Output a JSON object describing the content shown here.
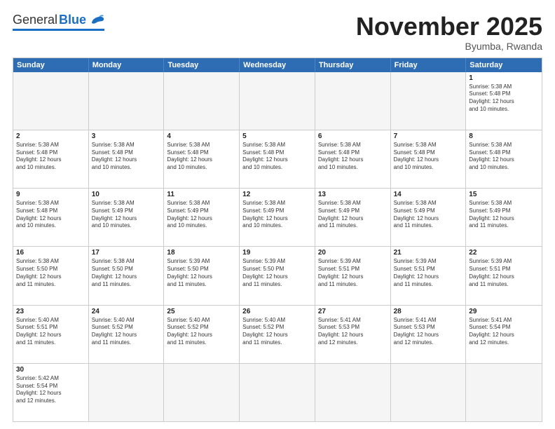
{
  "header": {
    "logo_general": "General",
    "logo_blue": "Blue",
    "month_title": "November 2025",
    "subtitle": "Byumba, Rwanda"
  },
  "weekdays": [
    "Sunday",
    "Monday",
    "Tuesday",
    "Wednesday",
    "Thursday",
    "Friday",
    "Saturday"
  ],
  "weeks": [
    [
      {
        "day": "",
        "empty": true
      },
      {
        "day": "",
        "empty": true
      },
      {
        "day": "",
        "empty": true
      },
      {
        "day": "",
        "empty": true
      },
      {
        "day": "",
        "empty": true
      },
      {
        "day": "",
        "empty": true
      },
      {
        "day": "1",
        "sunrise": "5:38 AM",
        "sunset": "5:48 PM",
        "daylight": "12 hours and 10 minutes."
      }
    ],
    [
      {
        "day": "2",
        "sunrise": "5:38 AM",
        "sunset": "5:48 PM",
        "daylight": "12 hours and 10 minutes."
      },
      {
        "day": "3",
        "sunrise": "5:38 AM",
        "sunset": "5:48 PM",
        "daylight": "12 hours and 10 minutes."
      },
      {
        "day": "4",
        "sunrise": "5:38 AM",
        "sunset": "5:48 PM",
        "daylight": "12 hours and 10 minutes."
      },
      {
        "day": "5",
        "sunrise": "5:38 AM",
        "sunset": "5:48 PM",
        "daylight": "12 hours and 10 minutes."
      },
      {
        "day": "6",
        "sunrise": "5:38 AM",
        "sunset": "5:48 PM",
        "daylight": "12 hours and 10 minutes."
      },
      {
        "day": "7",
        "sunrise": "5:38 AM",
        "sunset": "5:48 PM",
        "daylight": "12 hours and 10 minutes."
      },
      {
        "day": "8",
        "sunrise": "5:38 AM",
        "sunset": "5:48 PM",
        "daylight": "12 hours and 10 minutes."
      }
    ],
    [
      {
        "day": "9",
        "sunrise": "5:38 AM",
        "sunset": "5:48 PM",
        "daylight": "12 hours and 10 minutes."
      },
      {
        "day": "10",
        "sunrise": "5:38 AM",
        "sunset": "5:49 PM",
        "daylight": "12 hours and 10 minutes."
      },
      {
        "day": "11",
        "sunrise": "5:38 AM",
        "sunset": "5:49 PM",
        "daylight": "12 hours and 10 minutes."
      },
      {
        "day": "12",
        "sunrise": "5:38 AM",
        "sunset": "5:49 PM",
        "daylight": "12 hours and 10 minutes."
      },
      {
        "day": "13",
        "sunrise": "5:38 AM",
        "sunset": "5:49 PM",
        "daylight": "12 hours and 11 minutes."
      },
      {
        "day": "14",
        "sunrise": "5:38 AM",
        "sunset": "5:49 PM",
        "daylight": "12 hours and 11 minutes."
      },
      {
        "day": "15",
        "sunrise": "5:38 AM",
        "sunset": "5:49 PM",
        "daylight": "12 hours and 11 minutes."
      }
    ],
    [
      {
        "day": "16",
        "sunrise": "5:38 AM",
        "sunset": "5:50 PM",
        "daylight": "12 hours and 11 minutes."
      },
      {
        "day": "17",
        "sunrise": "5:38 AM",
        "sunset": "5:50 PM",
        "daylight": "12 hours and 11 minutes."
      },
      {
        "day": "18",
        "sunrise": "5:39 AM",
        "sunset": "5:50 PM",
        "daylight": "12 hours and 11 minutes."
      },
      {
        "day": "19",
        "sunrise": "5:39 AM",
        "sunset": "5:50 PM",
        "daylight": "12 hours and 11 minutes."
      },
      {
        "day": "20",
        "sunrise": "5:39 AM",
        "sunset": "5:51 PM",
        "daylight": "12 hours and 11 minutes."
      },
      {
        "day": "21",
        "sunrise": "5:39 AM",
        "sunset": "5:51 PM",
        "daylight": "12 hours and 11 minutes."
      },
      {
        "day": "22",
        "sunrise": "5:39 AM",
        "sunset": "5:51 PM",
        "daylight": "12 hours and 11 minutes."
      }
    ],
    [
      {
        "day": "23",
        "sunrise": "5:40 AM",
        "sunset": "5:51 PM",
        "daylight": "12 hours and 11 minutes."
      },
      {
        "day": "24",
        "sunrise": "5:40 AM",
        "sunset": "5:52 PM",
        "daylight": "12 hours and 11 minutes."
      },
      {
        "day": "25",
        "sunrise": "5:40 AM",
        "sunset": "5:52 PM",
        "daylight": "12 hours and 11 minutes."
      },
      {
        "day": "26",
        "sunrise": "5:40 AM",
        "sunset": "5:52 PM",
        "daylight": "12 hours and 11 minutes."
      },
      {
        "day": "27",
        "sunrise": "5:41 AM",
        "sunset": "5:53 PM",
        "daylight": "12 hours and 12 minutes."
      },
      {
        "day": "28",
        "sunrise": "5:41 AM",
        "sunset": "5:53 PM",
        "daylight": "12 hours and 12 minutes."
      },
      {
        "day": "29",
        "sunrise": "5:41 AM",
        "sunset": "5:54 PM",
        "daylight": "12 hours and 12 minutes."
      }
    ],
    [
      {
        "day": "30",
        "sunrise": "5:42 AM",
        "sunset": "5:54 PM",
        "daylight": "12 hours and 12 minutes."
      },
      {
        "day": "",
        "empty": true
      },
      {
        "day": "",
        "empty": true
      },
      {
        "day": "",
        "empty": true
      },
      {
        "day": "",
        "empty": true
      },
      {
        "day": "",
        "empty": true
      },
      {
        "day": "",
        "empty": true
      }
    ]
  ],
  "labels": {
    "sunrise": "Sunrise:",
    "sunset": "Sunset:",
    "daylight": "Daylight:"
  }
}
